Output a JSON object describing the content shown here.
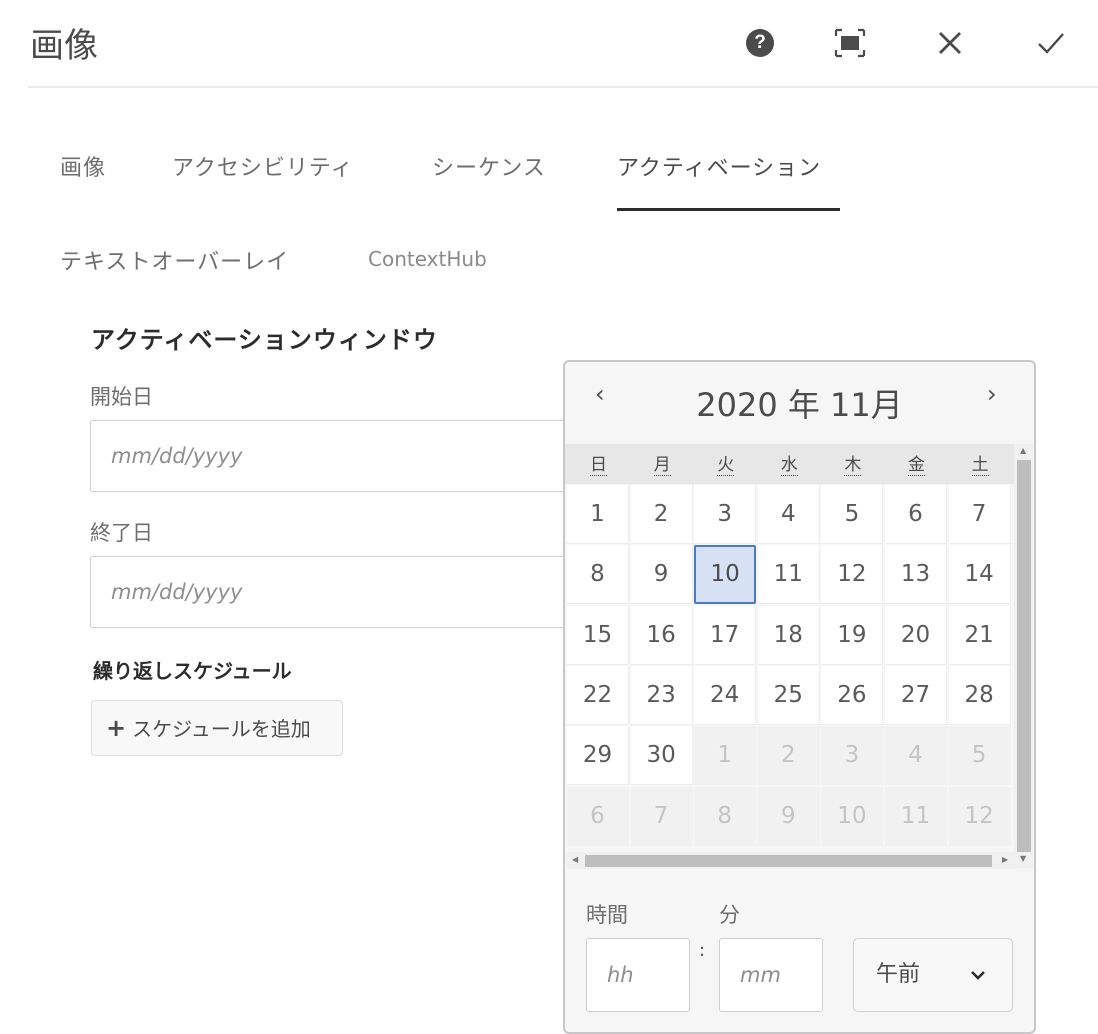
{
  "dialog": {
    "title": "画像",
    "icons": [
      "help-icon",
      "fullscreen-icon",
      "close-icon",
      "checkmark-icon"
    ],
    "help_glyph": "?"
  },
  "tabs": [
    {
      "label": "画像",
      "active": false
    },
    {
      "label": "アクセシビリティ",
      "active": false
    },
    {
      "label": "シーケンス",
      "active": false
    },
    {
      "label": "アクティベーション",
      "active": true
    },
    {
      "label": "テキストオーバーレイ",
      "active": false
    },
    {
      "label": "ContextHub",
      "active": false
    }
  ],
  "activation": {
    "section_title": "アクティベーションウィンドウ",
    "start_label": "開始日",
    "start_placeholder": "mm/dd/yyyy",
    "end_label": "終了日",
    "end_placeholder": "mm/dd/yyyy",
    "repeat_label": "繰り返しスケジュール",
    "add_schedule_label": "スケジュールを追加",
    "add_icon": "plus-icon"
  },
  "calendar": {
    "month_title": "2020 年 11月",
    "prev_glyph": "‹",
    "next_glyph": "›",
    "weekdays": [
      "日",
      "月",
      "火",
      "水",
      "木",
      "金",
      "土"
    ],
    "selected_day": "10",
    "weeks": [
      [
        {
          "d": "1"
        },
        {
          "d": "2"
        },
        {
          "d": "3"
        },
        {
          "d": "4"
        },
        {
          "d": "5"
        },
        {
          "d": "6"
        },
        {
          "d": "7"
        }
      ],
      [
        {
          "d": "8"
        },
        {
          "d": "9"
        },
        {
          "d": "10",
          "selected": true
        },
        {
          "d": "11"
        },
        {
          "d": "12"
        },
        {
          "d": "13"
        },
        {
          "d": "14"
        }
      ],
      [
        {
          "d": "15"
        },
        {
          "d": "16"
        },
        {
          "d": "17"
        },
        {
          "d": "18"
        },
        {
          "d": "19"
        },
        {
          "d": "20"
        },
        {
          "d": "21"
        }
      ],
      [
        {
          "d": "22"
        },
        {
          "d": "23"
        },
        {
          "d": "24"
        },
        {
          "d": "25"
        },
        {
          "d": "26"
        },
        {
          "d": "27"
        },
        {
          "d": "28"
        }
      ],
      [
        {
          "d": "29"
        },
        {
          "d": "30"
        },
        {
          "d": "1",
          "other": true
        },
        {
          "d": "2",
          "other": true
        },
        {
          "d": "3",
          "other": true
        },
        {
          "d": "4",
          "other": true
        },
        {
          "d": "5",
          "other": true
        }
      ],
      [
        {
          "d": "6",
          "other": true
        },
        {
          "d": "7",
          "other": true
        },
        {
          "d": "8",
          "other": true
        },
        {
          "d": "9",
          "other": true
        },
        {
          "d": "10",
          "other": true
        },
        {
          "d": "11",
          "other": true
        },
        {
          "d": "12",
          "other": true
        }
      ]
    ],
    "hour_label": "時間",
    "minute_label": "分",
    "hour_placeholder": "hh",
    "minute_placeholder": "mm",
    "colon": ":",
    "ampm_value": "午前"
  },
  "colors": {
    "selected_fill": "#d6e2f3",
    "selected_border": "#4a79c9",
    "tab_underline": "#2c2c2c"
  }
}
